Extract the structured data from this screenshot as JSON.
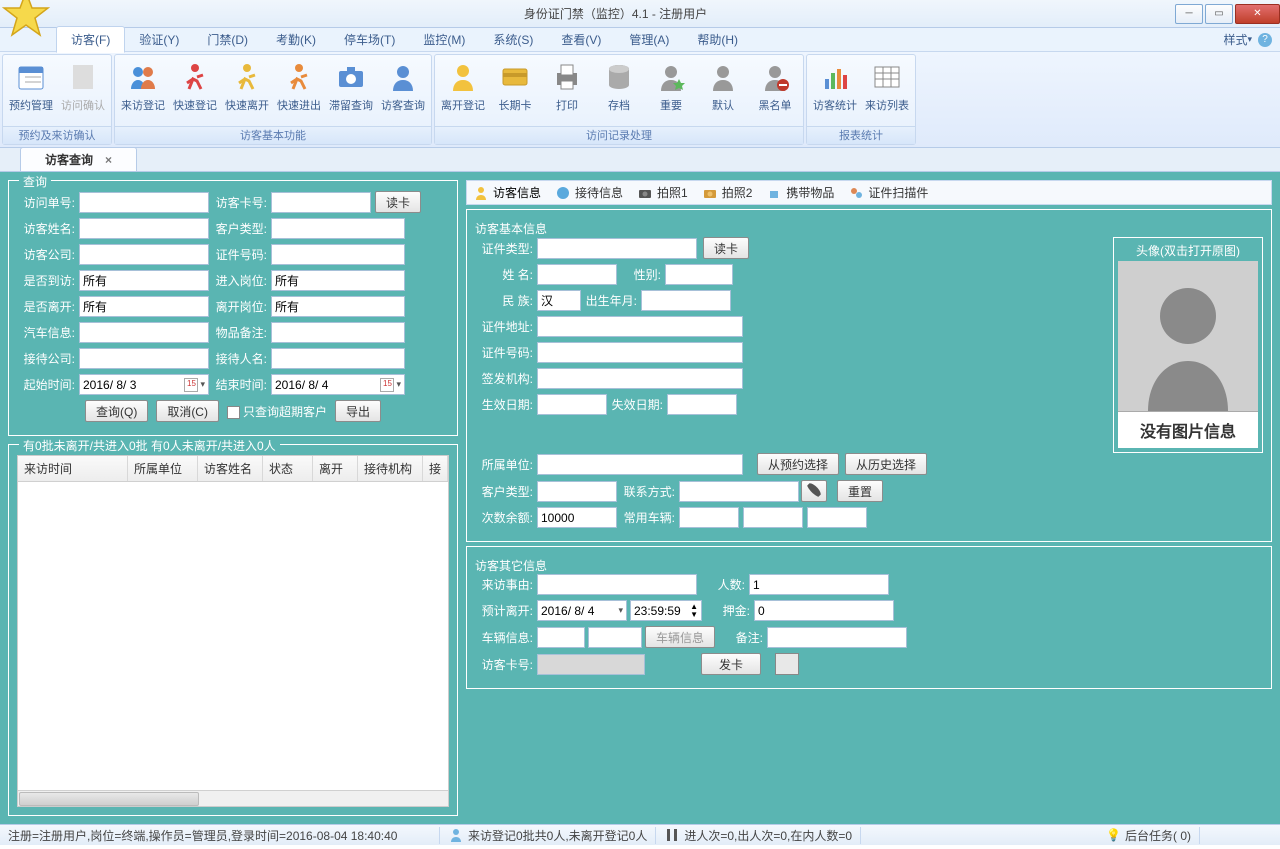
{
  "window": {
    "title": "身份证门禁（监控）4.1 - 注册用户"
  },
  "menubar": {
    "items": [
      "访客(F)",
      "验证(Y)",
      "门禁(D)",
      "考勤(K)",
      "停车场(T)",
      "监控(M)",
      "系统(S)",
      "查看(V)",
      "管理(A)",
      "帮助(H)"
    ],
    "style_label": "样式"
  },
  "ribbon": {
    "groups": [
      {
        "caption": "预约及来访确认",
        "buttons": [
          {
            "label": "预约管理",
            "icon": "calendar"
          },
          {
            "label": "访问确认",
            "icon": "confirm",
            "disabled": true
          }
        ]
      },
      {
        "caption": "访客基本功能",
        "buttons": [
          {
            "label": "来访登记",
            "icon": "visitors"
          },
          {
            "label": "快速登记",
            "icon": "runner-red"
          },
          {
            "label": "快速离开",
            "icon": "runner-yellow"
          },
          {
            "label": "快速进出",
            "icon": "runner-orange"
          },
          {
            "label": "滞留查询",
            "icon": "camera"
          },
          {
            "label": "访客查询",
            "icon": "head"
          }
        ]
      },
      {
        "caption": "访问记录处理",
        "buttons": [
          {
            "label": "离开登记",
            "icon": "yellow-man"
          },
          {
            "label": "长期卡",
            "icon": "card"
          },
          {
            "label": "打印",
            "icon": "printer"
          },
          {
            "label": "存档",
            "icon": "database"
          },
          {
            "label": "重要",
            "icon": "star-green"
          },
          {
            "label": "默认",
            "icon": "head-gray"
          },
          {
            "label": "黑名单",
            "icon": "head-black"
          }
        ]
      },
      {
        "caption": "报表统计",
        "buttons": [
          {
            "label": "访客统计",
            "icon": "chart"
          },
          {
            "label": "来访列表",
            "icon": "grid"
          }
        ]
      }
    ]
  },
  "doc_tab": {
    "label": "访客查询"
  },
  "query_box": {
    "legend": "查询",
    "labels": {
      "visit_no": "访问单号:",
      "card_no": "访客卡号:",
      "read": "读卡",
      "name": "访客姓名:",
      "cust_type": "客户类型:",
      "company": "访客公司:",
      "id_no": "证件号码:",
      "arrived": "是否到访:",
      "in_post": "进入岗位:",
      "left": "是否离开:",
      "out_post": "离开岗位:",
      "car": "汽车信息:",
      "goods": "物品备注:",
      "recv_comp": "接待公司:",
      "recv_name": "接待人名:",
      "start": "起始时间:",
      "end": "结束时间:"
    },
    "values": {
      "arrived": "所有",
      "in_post": "所有",
      "left": "所有",
      "out_post": "所有",
      "start": "2016/ 8/ 3",
      "end": "2016/ 8/ 4"
    },
    "btns": {
      "query": "查询(Q)",
      "cancel": "取消(C)",
      "overdue": "只查询超期客户",
      "export": "导出"
    }
  },
  "list_box": {
    "legend": "有0批未离开/共进入0批  有0人未离开/共进入0人",
    "cols": [
      "来访时间",
      "所属单位",
      "访客姓名",
      "状态",
      "离开",
      "接待机构",
      "接"
    ]
  },
  "right_tabs": [
    "访客信息",
    "接待信息",
    "拍照1",
    "拍照2",
    "携带物品",
    "证件扫描件"
  ],
  "visitor_box": {
    "legend": "访客基本信息",
    "avatar_caption": "头像(双击打开原图)",
    "noimg": "没有图片信息",
    "labels": {
      "id_type": "证件类型:",
      "read": "读卡",
      "name": "姓    名:",
      "sex": "性别:",
      "nation": "民    族:",
      "birth": "出生年月:",
      "addr": "证件地址:",
      "idno": "证件号码:",
      "issuer": "签发机构:",
      "valid": "生效日期:",
      "invalid": "失效日期:",
      "unit": "所属单位:",
      "from_booking": "从预约选择",
      "from_hist": "从历史选择",
      "cust_type": "客户类型:",
      "contact": "联系方式:",
      "reset": "重置",
      "remain": "次数余额:",
      "vehicle": "常用车辆:"
    },
    "values": {
      "nation": "汉",
      "remain": "10000"
    }
  },
  "other_box": {
    "legend": "访客其它信息",
    "labels": {
      "reason": "来访事由:",
      "persons": "人数:",
      "leave": "预计离开:",
      "deposit": "押金:",
      "car": "车辆信息:",
      "carbtn": "车辆信息",
      "note": "备注:",
      "card": "访客卡号:",
      "issue": "发卡"
    },
    "values": {
      "persons": "1",
      "deposit": "0",
      "leave_date": "2016/ 8/ 4",
      "leave_time": "23:59:59"
    }
  },
  "status": {
    "left": "注册=注册用户,岗位=终端,操作员=管理员,登录时间=2016-08-04 18:40:40",
    "mid1": "来访登记0批共0人,未离开登记0人",
    "mid2": "进人次=0,出人次=0,在内人数=0",
    "right": "后台任务(    0)"
  }
}
